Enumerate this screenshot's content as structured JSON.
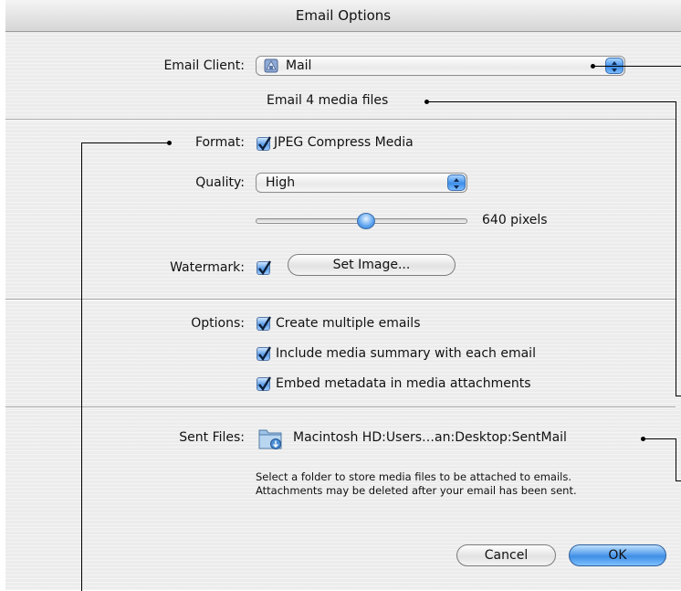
{
  "window": {
    "title": "Email Options"
  },
  "email_client": {
    "label": "Email Client:",
    "value": "Mail",
    "info": "Email 4 media files"
  },
  "format": {
    "label": "Format:",
    "option": "JPEG Compress Media",
    "checked": true
  },
  "quality": {
    "label": "Quality:",
    "value": "High",
    "pixels_text": "640 pixels",
    "slider_fraction": 0.52
  },
  "watermark": {
    "label": "Watermark:",
    "checked": true,
    "button": "Set Image..."
  },
  "options": {
    "label": "Options:",
    "items": [
      {
        "label": "Create multiple emails",
        "checked": true
      },
      {
        "label": "Include media summary with each email",
        "checked": true
      },
      {
        "label": "Embed metadata in media attachments",
        "checked": true
      }
    ]
  },
  "sent_files": {
    "label": "Sent Files:",
    "path": "Macintosh HD:Users…an:Desktop:SentMail",
    "help_line1": "Select a folder to store media files to be attached to emails.",
    "help_line2": "Attachments may be deleted after your email has been sent."
  },
  "buttons": {
    "cancel": "Cancel",
    "ok": "OK"
  },
  "colors": {
    "accent": "#3f8fe6",
    "panel": "#ececec"
  }
}
